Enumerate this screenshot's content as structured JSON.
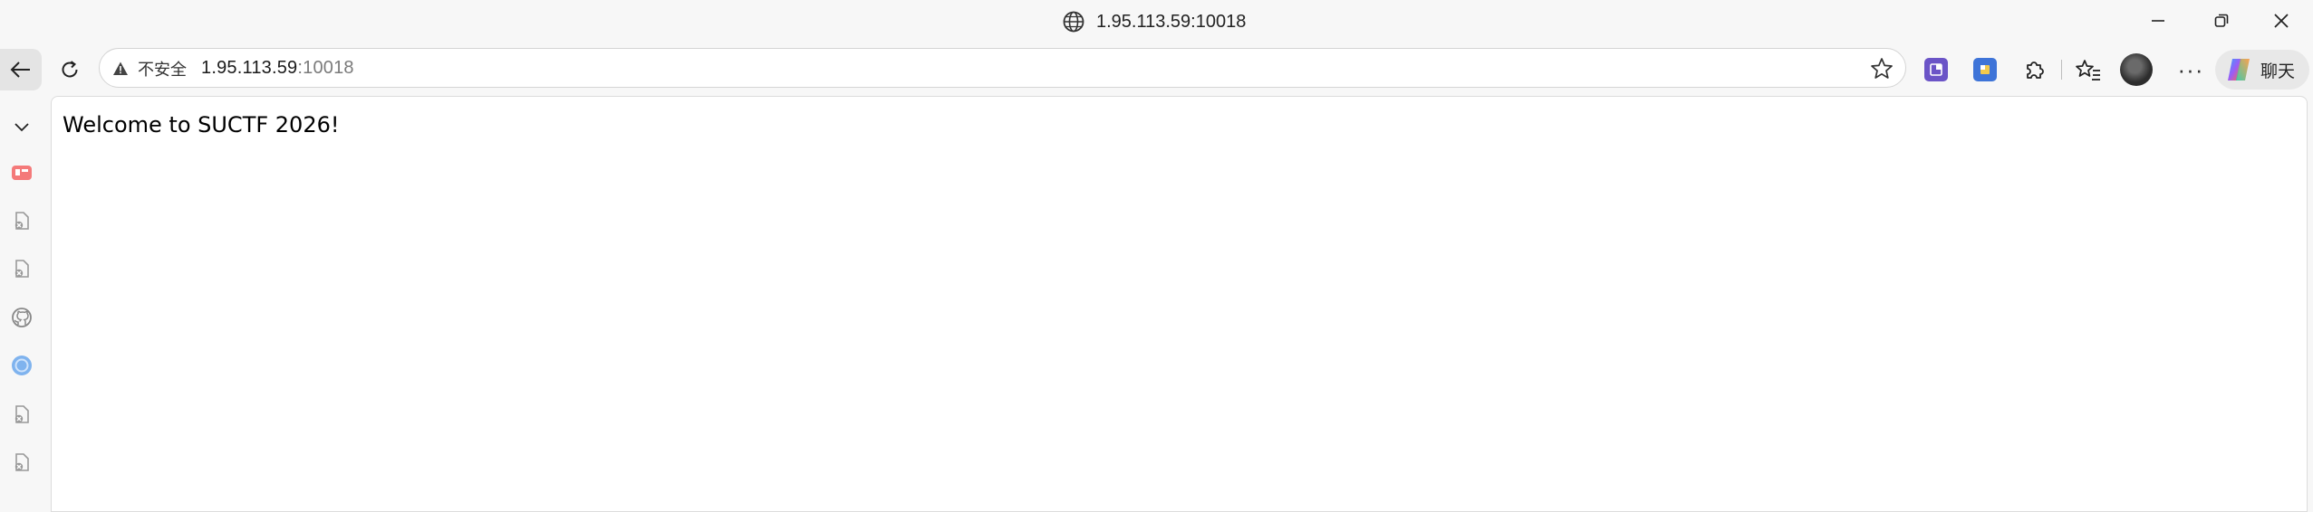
{
  "window": {
    "title": "1.95.113.59:10018"
  },
  "address_bar": {
    "security_label": "不安全",
    "url_host": "1.95.113.59",
    "url_port": ":10018"
  },
  "toolbar": {
    "chat_label": "聊天"
  },
  "sidebar": {
    "items": [
      {
        "icon": "chevron-down-icon"
      },
      {
        "icon": "red-app-icon"
      },
      {
        "icon": "broken-page-icon"
      },
      {
        "icon": "broken-page-icon"
      },
      {
        "icon": "github-icon"
      },
      {
        "icon": "blue-circle-icon"
      },
      {
        "icon": "broken-page-icon"
      },
      {
        "icon": "broken-page-icon"
      }
    ]
  },
  "page": {
    "heading": "Welcome to SUCTF 2026!"
  },
  "colors": {
    "chrome_bg": "#f7f7f7",
    "extension_purple": "#6b54c7",
    "extension_blue": "#3e74d8"
  }
}
